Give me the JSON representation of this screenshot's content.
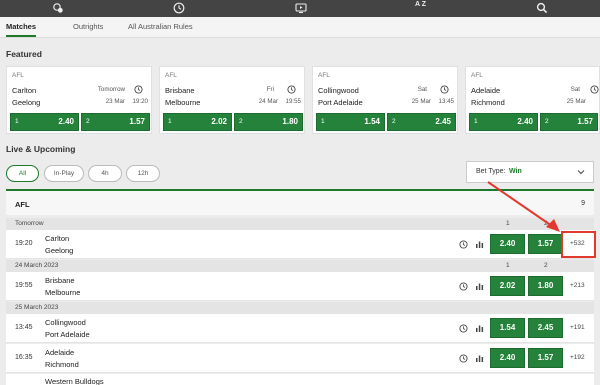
{
  "topbar": {
    "icons": [
      "sports-icon",
      "clock-icon",
      "tv-icon",
      "az-sort-icon",
      "search-icon"
    ],
    "az_text": "A Z"
  },
  "subtabs": [
    "Matches",
    "Outrights",
    "All Australian Rules"
  ],
  "featured": {
    "title": "Featured",
    "cards": [
      {
        "league": "AFL",
        "team1": "Carlton",
        "team2": "Geelong",
        "when": "Tomorrow",
        "date": "23 Mar",
        "time": "19:20",
        "odds": [
          {
            "label": "1",
            "value": "2.40"
          },
          {
            "label": "2",
            "value": "1.57"
          }
        ]
      },
      {
        "league": "AFL",
        "team1": "Brisbane",
        "team2": "Melbourne",
        "when": "Fri",
        "date": "24 Mar",
        "time": "19:55",
        "odds": [
          {
            "label": "1",
            "value": "2.02"
          },
          {
            "label": "2",
            "value": "1.80"
          }
        ]
      },
      {
        "league": "AFL",
        "team1": "Collingwood",
        "team2": "Port Adelaide",
        "when": "Sat",
        "date": "25 Mar",
        "time": "13:45",
        "odds": [
          {
            "label": "1",
            "value": "1.54"
          },
          {
            "label": "2",
            "value": "2.45"
          }
        ]
      },
      {
        "league": "AFL",
        "team1": "Adelaide",
        "team2": "Richmond",
        "when": "Sat",
        "date": "25 Mar",
        "time": "",
        "odds": [
          {
            "label": "1",
            "value": "2.40"
          },
          {
            "label": "2",
            "value": "1.57"
          }
        ]
      }
    ]
  },
  "live": {
    "title": "Live & Upcoming",
    "filters": [
      "All",
      "In-Play",
      "4h",
      "12h"
    ],
    "bet_type_label": "Bet Type:",
    "bet_type_value": "Win"
  },
  "league": {
    "name": "AFL",
    "count": "9"
  },
  "date_groups": [
    {
      "label": "Tomorrow",
      "col1": "1",
      "col2": "2",
      "events": [
        {
          "time": "19:20",
          "team1": "Carlton",
          "team2": "Geelong",
          "odd1": "2.40",
          "odd2": "1.57",
          "more": "+532"
        }
      ]
    },
    {
      "label": "24 March 2023",
      "col1": "1",
      "col2": "2",
      "events": [
        {
          "time": "19:55",
          "team1": "Brisbane",
          "team2": "Melbourne",
          "odd1": "2.02",
          "odd2": "1.80",
          "more": "+213"
        }
      ]
    },
    {
      "label": "25 March 2023",
      "col1": "",
      "col2": "",
      "events": [
        {
          "time": "13:45",
          "team1": "Collingwood",
          "team2": "Port Adelaide",
          "odd1": "1.54",
          "odd2": "2.45",
          "more": "+191"
        },
        {
          "time": "16:35",
          "team1": "Adelaide",
          "team2": "Richmond",
          "odd1": "2.40",
          "odd2": "1.57",
          "more": "+192"
        },
        {
          "time": "",
          "team1": "Western Bulldogs",
          "team2": "",
          "odd1": "",
          "odd2": "",
          "more": ""
        }
      ]
    }
  ],
  "colors": {
    "accent": "#25823a",
    "highlight": "#e03a2e"
  }
}
